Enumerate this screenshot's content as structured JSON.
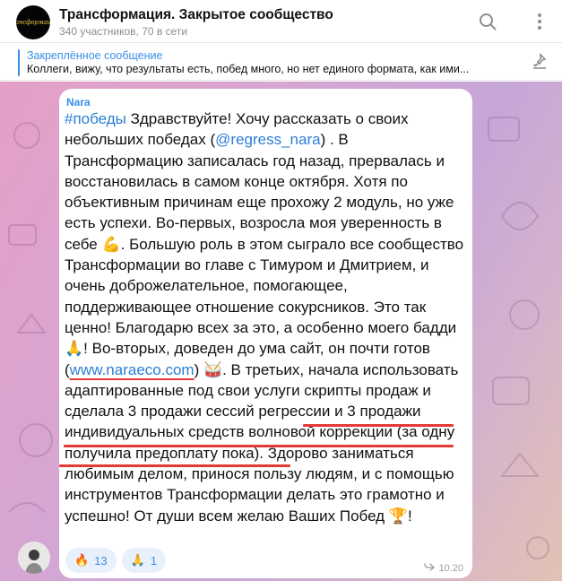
{
  "header": {
    "title": "Трансформация. Закрытое сообщество",
    "subtitle": "340 участников, 70 в сети",
    "avatar_logo": "Трансформация",
    "icons": [
      "search-icon",
      "more-vertical-icon"
    ]
  },
  "pinned": {
    "label": "Закреплённое сообщение",
    "text": "Коллеги, вижу, что результаты есть, побед много, но нет единого формата, как ими...",
    "icon": "pin-list-icon"
  },
  "message": {
    "sender": "Nara",
    "hashtag": "#победы",
    "t1": " Здравствуйте! Хочу рассказать о своих небольших победах (",
    "mention": "@regress_nara",
    "t2": ") . В Трансформацию записалась год назад, прервалась и восстановилась в самом конце октября. Хотя по объективным причинам еще прохожу 2 модуль, но уже есть успехи. Во-первых, возросла моя уверенность в себе 💪. Большую роль в этом сыграло все сообщество Трансформации во главе с Тимуром и Дмитрием, и очень доброжелательное, помогающее, поддерживающее отношение сокурсников. Это так ценно! Благодарю всех за это, а особенно моего бадди 🙏! Во-вторых, доведен до ума сайт, он почти готов (",
    "website": "www.naraeco.com",
    "t3": ") 🥁. В третьих, начала использовать адаптированные под свои услуги скрипты продаж и ",
    "highlight1": "сделала 3 продажи",
    "t4": " ",
    "highlight2": "сессий регрессии и 3 продажи индивидуальных",
    "t5": " ",
    "highlight3": "средств волновой коррекции",
    "t6": " (за одну получила предоплату пока). Здорово заниматься любимым делом, принося пользу людям, и с помощью инструментов Трансформации делать это грамотно и успешно! От души всем желаю Ваших Побед 🏆!",
    "reactions": [
      {
        "emoji": "🔥",
        "count": "13"
      },
      {
        "emoji": "🙏",
        "count": "1"
      }
    ],
    "time": "10.20",
    "status_icon": "forwarded-icon"
  },
  "colors": {
    "accent": "#3a8ee6",
    "underline": "#e53935",
    "chat_bg_start": "#e4a0c6",
    "chat_bg_end": "#e2c2b3"
  }
}
